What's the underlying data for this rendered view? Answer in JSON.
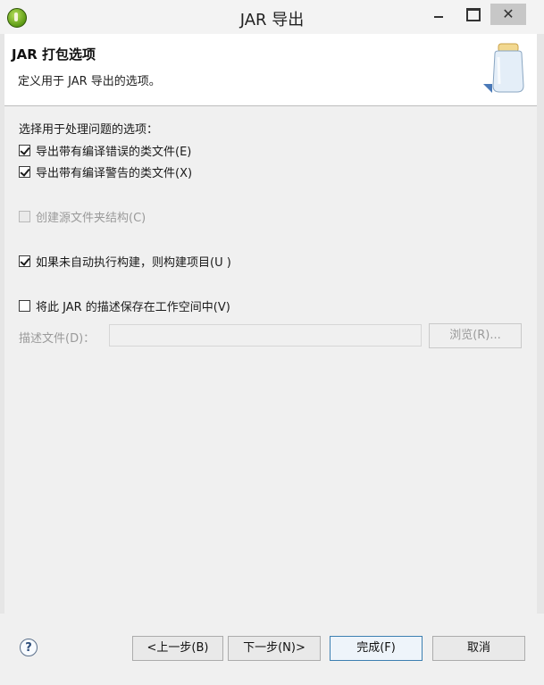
{
  "window": {
    "title": "JAR 导出"
  },
  "banner": {
    "title": "JAR 打包选项",
    "description": "定义用于 JAR 导出的选项。"
  },
  "options": {
    "section_label": "选择用于处理问题的选项：",
    "export_errors": {
      "label": "导出带有编译错误的类文件(E)",
      "checked": true
    },
    "export_warnings": {
      "label": "导出带有编译警告的类文件(X)",
      "checked": true
    },
    "create_source_folder": {
      "label": "创建源文件夹结构(C)",
      "checked": false,
      "enabled": false
    },
    "build_if_not_auto": {
      "label": "如果未自动执行构建，则构建项目(U )",
      "checked": true
    },
    "save_description": {
      "label": "将此 JAR 的描述保存在工作空间中(V)",
      "checked": false
    },
    "description_file": {
      "label": "描述文件(D)：",
      "value": ""
    },
    "browse_label": "浏览(R)..."
  },
  "footer": {
    "back_label": "<上一步(B)",
    "next_label": "下一步(N)>",
    "finish_label": "完成(F)",
    "cancel_label": "取消"
  },
  "icons": {
    "app": "eclipse-icon",
    "banner": "jar-icon",
    "help": "help-icon"
  },
  "colors": {
    "banner_bg": "#ffffff",
    "content_bg": "#f0f0f0",
    "disabled_text": "#9a9a9a"
  }
}
